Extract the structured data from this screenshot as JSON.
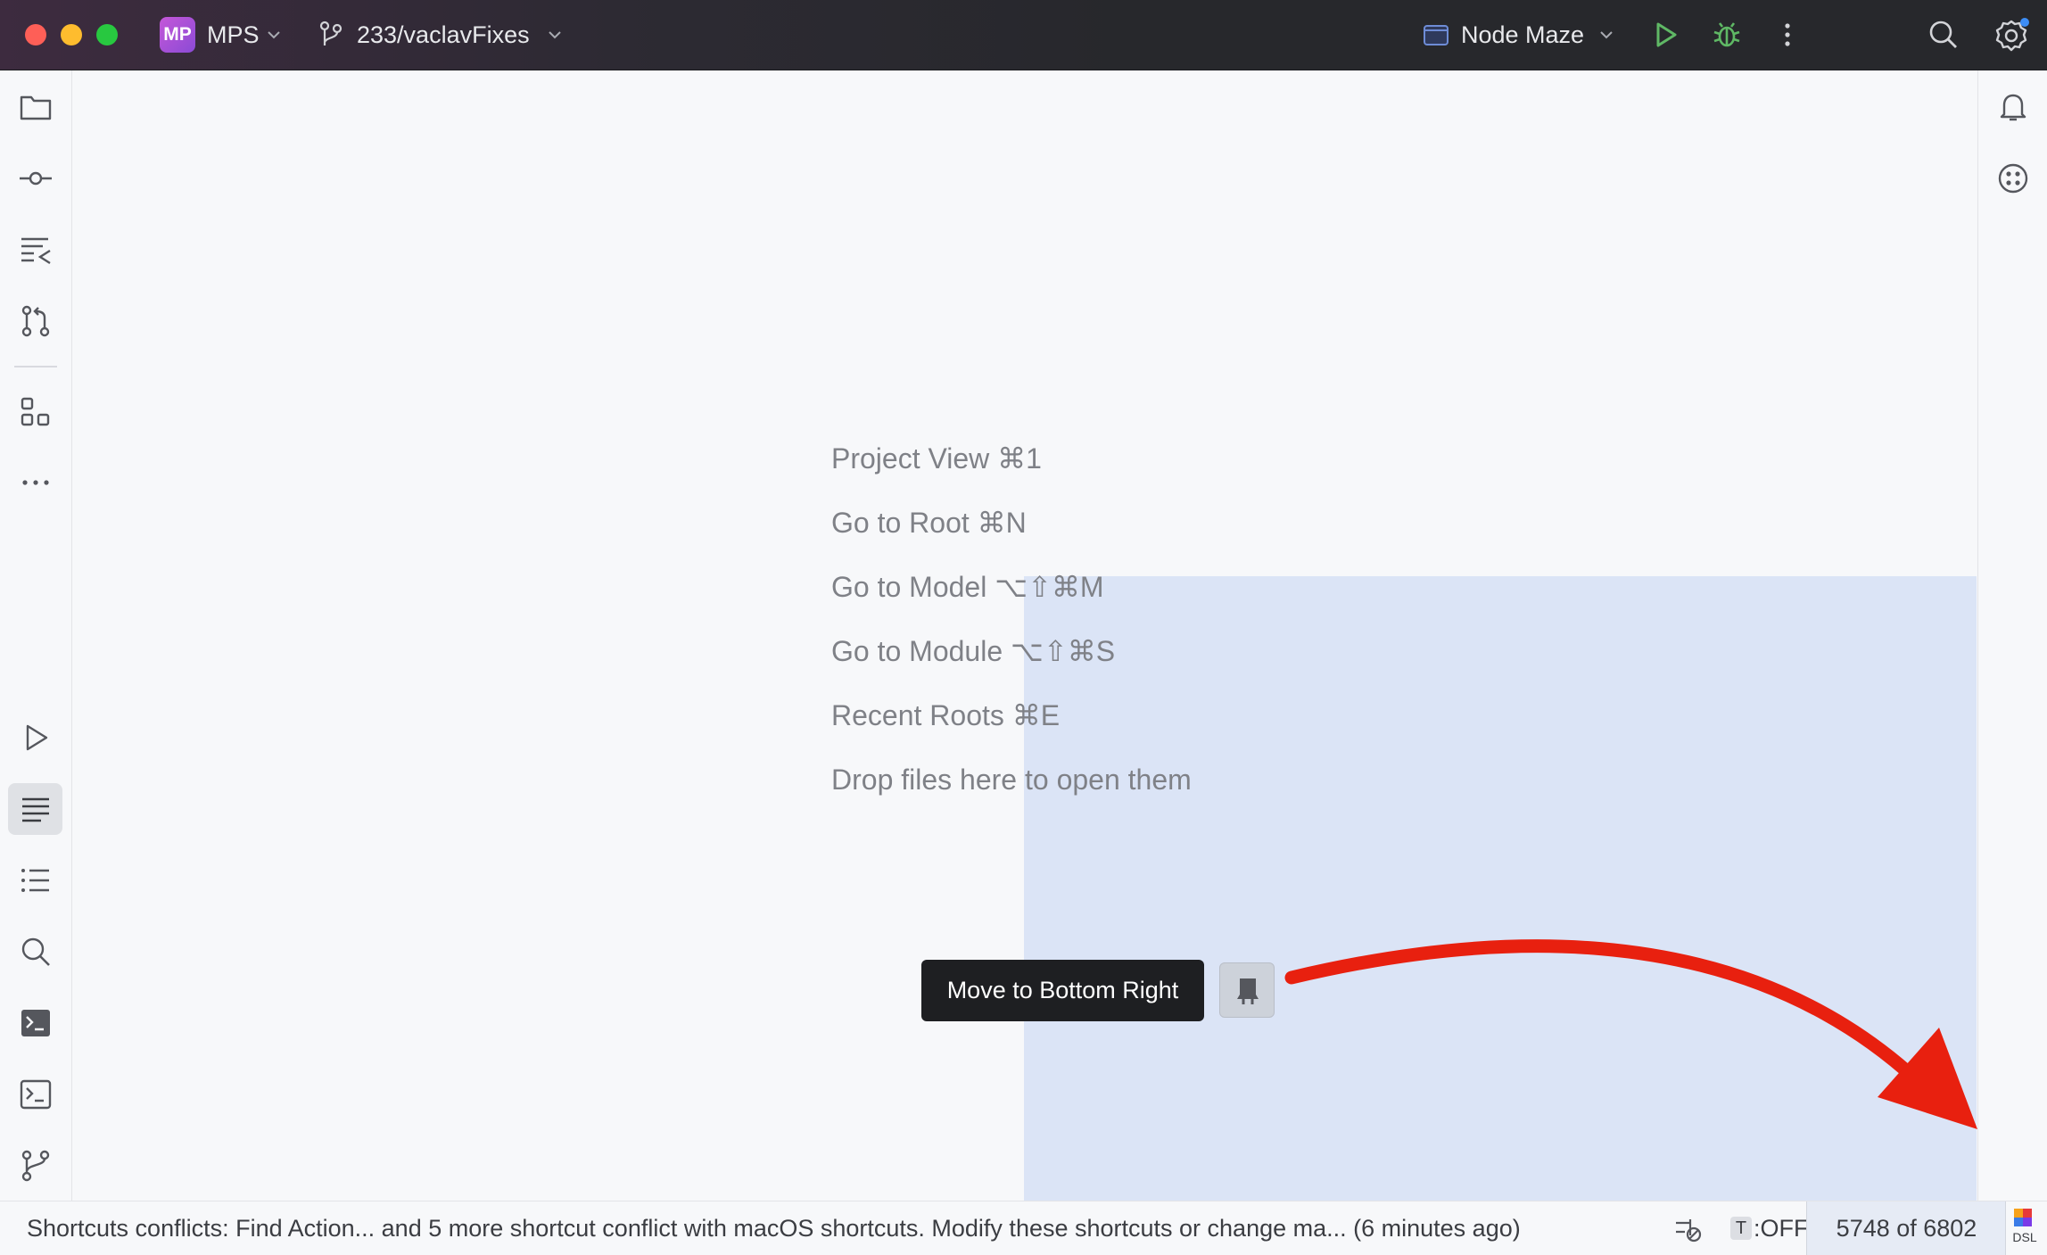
{
  "titlebar": {
    "project_badge": "MP",
    "project_name": "MPS",
    "branch": "233/vaclavFixes",
    "run_config": "Node Maze"
  },
  "editor": {
    "hints": [
      "Project View ⌘1",
      "Go to Root ⌘N",
      "Go to Model ⌥⇧⌘M",
      "Go to Module ⌥⇧⌘S",
      "Recent Roots ⌘E",
      "Drop files here to open them"
    ],
    "tooltip": "Move to Bottom Right"
  },
  "statusbar": {
    "message": "Shortcuts conflicts: Find Action... and 5 more shortcut conflict with macOS shortcuts. Modify these shortcuts or change ma... (6 minutes ago)",
    "t_badge": "T",
    "t_state": ":OFF",
    "position": "5748 of 6802",
    "dsl_label": "DSL"
  },
  "colors": {
    "annotation_arrow": "#e8200f",
    "drop_highlight": "#dbe4f6",
    "run_green": "#4caf50"
  }
}
